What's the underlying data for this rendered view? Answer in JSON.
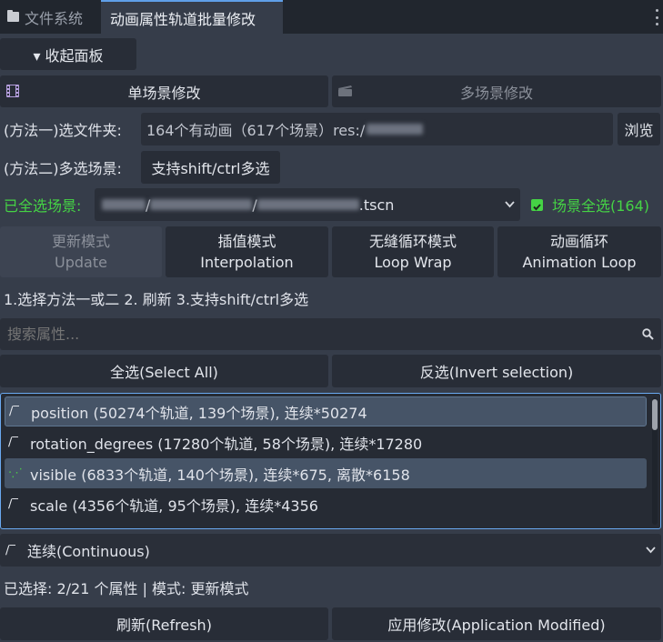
{
  "tabs": [
    {
      "label": "文件系统",
      "icon": "folder-icon",
      "active": false
    },
    {
      "label": "动画属性轨道批量修改",
      "active": true
    }
  ],
  "collapse_button": "▾ 收起面板",
  "mode_buttons": {
    "single": "单场景修改",
    "multi": "多场景修改"
  },
  "method1": {
    "label": "(方法一)选文件夹:",
    "value_prefix": "164个有动画（617个场景）res:/",
    "browse": "浏览"
  },
  "method2": {
    "label": "(方法二)多选场景:",
    "button": "支持shift/ctrl多选"
  },
  "scene_select": {
    "label": "已全选场景:",
    "path_suffix": ".tscn",
    "select_all_check": "场景全选(164)",
    "checked": true
  },
  "mode_tabs": [
    {
      "zh": "更新模式",
      "en": "Update",
      "disabled": true
    },
    {
      "zh": "插值模式",
      "en": "Interpolation",
      "disabled": false
    },
    {
      "zh": "无缝循环模式",
      "en": "Loop Wrap",
      "disabled": false
    },
    {
      "zh": "动画循环",
      "en": "Animation Loop",
      "disabled": false
    }
  ],
  "hint": "1.选择方法一或二 2. 刷新 3.支持shift/ctrl多选",
  "search": {
    "placeholder": "搜索属性..."
  },
  "select_all": "全选(Select All)",
  "invert_selection": "反选(Invert selection)",
  "properties": [
    {
      "icon": "continuous",
      "text": "position (50274个轨道, 139个场景), 连续*50274",
      "selected": true
    },
    {
      "icon": "continuous",
      "text": "rotation_degrees (17280个轨道, 58个场景), 连续*17280",
      "selected": false
    },
    {
      "icon": "discrete",
      "text": "visible (6833个轨道, 140个场景), 连续*675, 离散*6158",
      "selected": true
    },
    {
      "icon": "continuous",
      "text": "scale (4356个轨道, 95个场景), 连续*4356",
      "selected": false
    }
  ],
  "update_mode_select": "连续(Continuous)",
  "status": "已选择: 2/21 个属性 | 模式: 更新模式",
  "refresh": "刷新(Refresh)",
  "apply": "应用修改(Application Modified)",
  "colors": {
    "accent": "#5f9fe8",
    "green": "#45d345",
    "panel": "#363d4a",
    "button": "#282d37"
  }
}
